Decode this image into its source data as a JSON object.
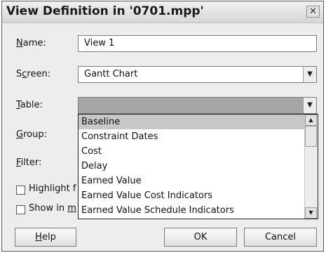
{
  "window": {
    "title": "View Definition in '0701.mpp'",
    "close_glyph": "✕"
  },
  "fields": {
    "name": {
      "label_key": "N",
      "label_rest": "ame:",
      "value": "View 1"
    },
    "screen": {
      "label_pre": "S",
      "label_key": "c",
      "label_rest": "reen:",
      "value": "Gantt Chart"
    },
    "table": {
      "label_key": "T",
      "label_rest": "able:",
      "value": ""
    },
    "group": {
      "label_key": "G",
      "label_rest": "roup:"
    },
    "filter": {
      "label_key": "F",
      "label_rest": "ilter:"
    }
  },
  "table_dropdown": {
    "selected": "Baseline",
    "items": [
      "Baseline",
      "Constraint Dates",
      "Cost",
      "Delay",
      "Earned Value",
      "Earned Value Cost Indicators",
      "Earned Value Schedule Indicators"
    ]
  },
  "options": {
    "highlight_label": "Highlight f",
    "show_in_menu_pre": "Show in ",
    "show_in_menu_key": "m"
  },
  "buttons": {
    "help_key": "H",
    "help_rest": "elp",
    "ok": "OK",
    "cancel": "Cancel"
  },
  "icons": {
    "dropdown_arrow": "▼",
    "scroll_up": "▲",
    "scroll_down": "▼"
  }
}
